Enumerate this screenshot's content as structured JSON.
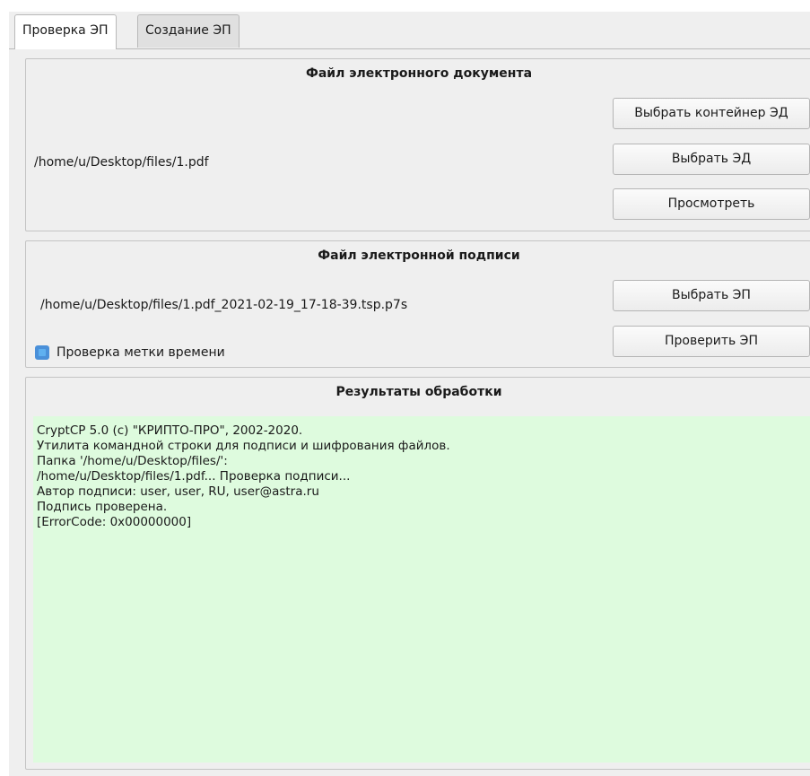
{
  "tabs": [
    {
      "label": "Проверка ЭП",
      "active": true
    },
    {
      "label": "Создание ЭП",
      "active": false
    }
  ],
  "document_group": {
    "title": "Файл электронного документа",
    "path": "/home/u/Desktop/files/1.pdf",
    "buttons": {
      "select_container": "Выбрать контейнер ЭД",
      "select_doc": "Выбрать ЭД",
      "view": "Просмотреть"
    }
  },
  "signature_group": {
    "title": "Файл электронной подписи",
    "path": "/home/u/Desktop/files/1.pdf_2021-02-19_17-18-39.tsp.p7s",
    "timestamp_check_label": "Проверка метки времени",
    "timestamp_check_checked": true,
    "buttons": {
      "select_sig": "Выбрать ЭП",
      "verify_sig": "Проверить ЭП"
    }
  },
  "results_group": {
    "title": "Результаты обработки",
    "output": "CryptCP 5.0 (c) \"КРИПТО-ПРО\", 2002-2020.\nУтилита командной строки для подписи и шифрования файлов.\nПапка '/home/u/Desktop/files/':\n/home/u/Desktop/files/1.pdf... Проверка подписи...\nАвтор подписи: user, user, RU, user@astra.ru\nПодпись проверена.\n[ErrorCode: 0x00000000]",
    "output_bg_color": "#defbde"
  },
  "colors": {
    "checkbox_accent": "#4a90d9"
  }
}
